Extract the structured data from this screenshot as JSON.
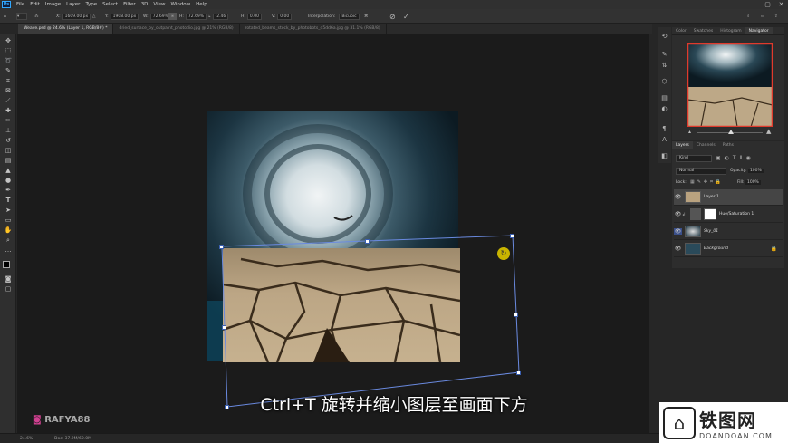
{
  "menubar": {
    "app_icon": "Ps",
    "items": [
      "File",
      "Edit",
      "Image",
      "Layer",
      "Type",
      "Select",
      "Filter",
      "3D",
      "View",
      "Window",
      "Help"
    ],
    "window_controls": [
      "–",
      "▢",
      "✕"
    ]
  },
  "options": {
    "x_label": "X:",
    "x_value": "1609.00 px",
    "y_label": "Y:",
    "y_value": "1908.00 px",
    "w_label": "W:",
    "w_value": "72.69%",
    "h_label": "H:",
    "h_value": "72.69%",
    "angle_value": "-2.46",
    "hskew_label": "H:",
    "hskew_value": "0.00",
    "vskew_label": "V:",
    "vskew_value": "0.00",
    "interp_label": "Interpolation:",
    "interp_value": "Bicubic"
  },
  "tabs": [
    {
      "label": "Weave.psd @ 24.6% (Layer 1, RGB/8#) *",
      "active": true
    },
    {
      "label": "dried_surface_by_outpaint_photodio.jpg @ 21% (RGB/8)",
      "active": false
    },
    {
      "label": "rotated_beams_stock_by_photobots_d5dd6a.jpg @ 31.1% (RGB/8)",
      "active": false
    }
  ],
  "nav_tabs": [
    "Color",
    "Swatches",
    "Histogram",
    "Navigator"
  ],
  "nav_zoom": "24.6%",
  "layers_tabs": [
    "Layers",
    "Channels",
    "Paths"
  ],
  "layers": {
    "kind_label": "Kind",
    "blend_mode": "Normal",
    "opacity_label": "Opacity:",
    "opacity_value": "100%",
    "lock_label": "Lock:",
    "fill_label": "Fill:",
    "fill_value": "100%",
    "rows": [
      {
        "name": "Layer 1"
      },
      {
        "name": "Hue/Saturation 1"
      },
      {
        "name": "Sky_01"
      },
      {
        "name": "Background"
      }
    ]
  },
  "status": {
    "zoom": "24.6%",
    "doc": "Doc: 37.9M/60.0M"
  },
  "caption": "Ctrl+T 旋转并缩小图层至画面下方",
  "watermark": "RAFYA88",
  "logo": {
    "top": "铁图网",
    "bottom": "DOANDOAN.COM"
  },
  "colors": {
    "accent": "#31a8ff",
    "bbox": "#5a7fd0"
  }
}
